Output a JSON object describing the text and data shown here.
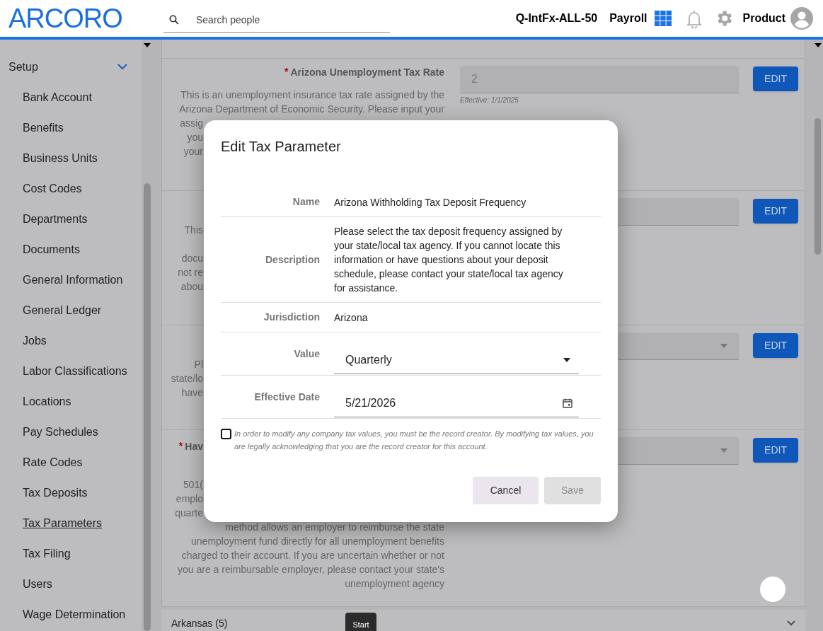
{
  "header": {
    "logo": "ARCORO",
    "search": {
      "placeholder": "Search people"
    },
    "company": "Q-IntFx-ALL-50",
    "module": "Payroll",
    "user": "Product"
  },
  "sidebar": {
    "section": {
      "label": "Setup",
      "expanded": true
    },
    "items": [
      {
        "label": "Bank Account",
        "selected": false
      },
      {
        "label": "Benefits",
        "selected": false
      },
      {
        "label": "Business Units",
        "selected": false
      },
      {
        "label": "Cost Codes",
        "selected": false
      },
      {
        "label": "Departments",
        "selected": false
      },
      {
        "label": "Documents",
        "selected": false
      },
      {
        "label": "General Information",
        "selected": false
      },
      {
        "label": "General Ledger",
        "selected": false
      },
      {
        "label": "Jobs",
        "selected": false
      },
      {
        "label": "Labor Classifications",
        "selected": false
      },
      {
        "label": "Locations",
        "selected": false
      },
      {
        "label": "Pay Schedules",
        "selected": false
      },
      {
        "label": "Rate Codes",
        "selected": false
      },
      {
        "label": "Tax Deposits",
        "selected": false
      },
      {
        "label": "Tax Parameters",
        "selected": true
      },
      {
        "label": "Tax Filing",
        "selected": false
      },
      {
        "label": "Users",
        "selected": false
      },
      {
        "label": "Wage Determination",
        "selected": false
      }
    ]
  },
  "parameters": [
    {
      "label": {
        "text": "Arizona Unemployment Tax Rate",
        "kind": "full"
      },
      "required_mark": "*",
      "lines": [
        {
          "text": "This is an unemployment insurance tax rate assigned by the",
          "kind": "full"
        },
        {
          "text": "Arizona Department of Economic Security. Please input your",
          "kind": "full"
        },
        {
          "text": "assig",
          "kind": "partial"
        },
        {
          "text": "you",
          "kind": "partial"
        },
        {
          "text": "your",
          "kind": "partial"
        }
      ],
      "field": {
        "kind": "text",
        "value": "2",
        "note": "Effective: 1/1/2025"
      },
      "edit": "EDIT"
    },
    {
      "lines": [
        {
          "text": "This",
          "kind": "partial"
        },
        {
          "text": "docu",
          "kind": "partial"
        },
        {
          "text": "not re",
          "kind": "partial"
        },
        {
          "text": "abou",
          "kind": "partial"
        }
      ],
      "field": {
        "kind": "text"
      },
      "edit": "EDIT"
    },
    {
      "lines": [
        {
          "text": "Pl",
          "kind": "partial"
        },
        {
          "text": "state/lo",
          "kind": "partial"
        },
        {
          "text": "have",
          "kind": "partial"
        }
      ],
      "field": {
        "kind": "select"
      },
      "edit": "EDIT"
    },
    {
      "label": {
        "text": "Hav",
        "kind": "partial"
      },
      "required_mark": "*",
      "lines": [
        {
          "text": "501(",
          "kind": "partial"
        },
        {
          "text": "emplo",
          "kind": "partial"
        },
        {
          "text": "quarte",
          "kind": "partial"
        },
        {
          "text": "method allows an employer to reimburse the state",
          "kind": "full"
        },
        {
          "text": "unemployment fund directly for all unemployment benefits",
          "kind": "full"
        },
        {
          "text": "charged to their account. If you are uncertain whether or not",
          "kind": "full"
        },
        {
          "text": "you are a reimbursable employer, please contact your state's",
          "kind": "full"
        },
        {
          "text": "unemployment agency",
          "kind": "full"
        }
      ],
      "field": {
        "kind": "select"
      },
      "edit": "EDIT"
    }
  ],
  "next_group": {
    "label": "Arkansas (5)",
    "expanded": false
  },
  "tooltip": "Start",
  "modal": {
    "title": "Edit Tax Parameter",
    "rows": [
      {
        "label": "Name",
        "kind": "text",
        "value": "Arizona Withholding Tax Deposit Frequency"
      },
      {
        "label": "Description",
        "kind": "text",
        "value": "Please select the tax deposit frequency assigned by your state/local tax agency. If you cannot locate this information or have questions about your deposit schedule, please contact your state/local tax agency for assistance."
      },
      {
        "label": "Jurisdiction",
        "kind": "text",
        "value": "Arizona"
      },
      {
        "label": "Value",
        "kind": "select",
        "value": "Quarterly"
      },
      {
        "label": "Effective Date",
        "kind": "date",
        "value": "5/21/2026"
      }
    ],
    "acknowledge": {
      "checked": false,
      "text": "In order to modify any company tax values, you must be the record creator. By modifying tax values, you are legally acknowledging that you are the record creator for this account."
    },
    "buttons": [
      {
        "label": "Cancel",
        "kind": "secondary",
        "disabled": false
      },
      {
        "label": "Save",
        "kind": "primary",
        "disabled": true
      }
    ]
  }
}
